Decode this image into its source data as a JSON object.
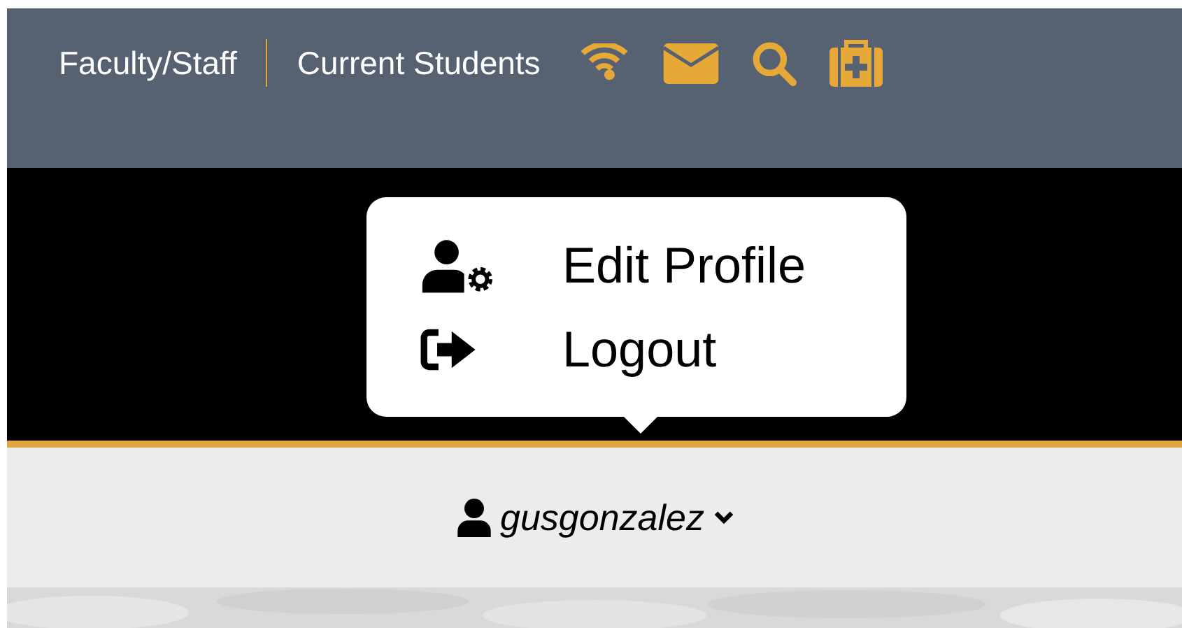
{
  "top_nav": {
    "links": [
      {
        "label": "Faculty/Staff"
      },
      {
        "label": "Current Students"
      }
    ],
    "icons": [
      {
        "kind": "wifi"
      },
      {
        "kind": "mail"
      },
      {
        "kind": "search"
      },
      {
        "kind": "medkit"
      }
    ]
  },
  "user_menu": {
    "username": "gusgonzalez",
    "expanded": true,
    "items": [
      {
        "kind": "profile",
        "label": "Edit Profile"
      },
      {
        "kind": "logout",
        "label": "Logout"
      }
    ]
  }
}
